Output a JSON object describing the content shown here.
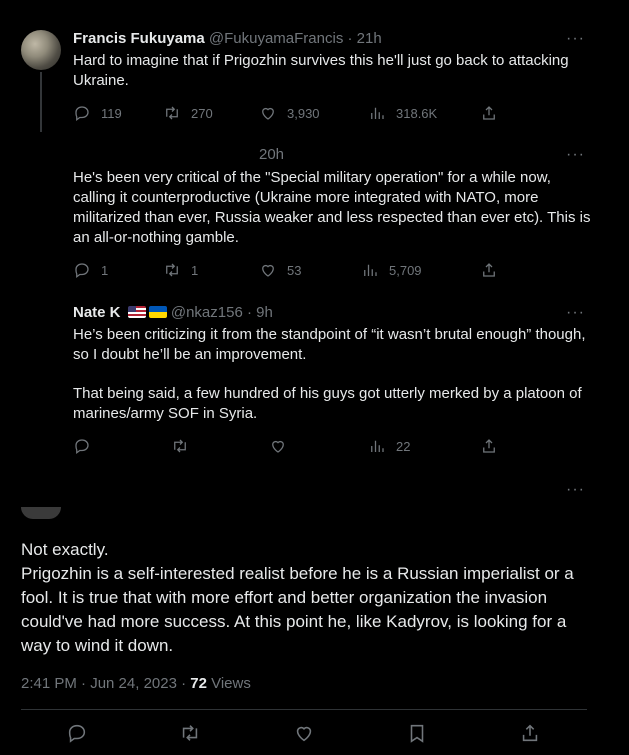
{
  "tweets": [
    {
      "name": "Francis Fukuyama",
      "handle": "@FukuyamaFrancis",
      "time": "· 21h",
      "text": "Hard to imagine that if Prigozhin survives this he'll just go back to attacking Ukraine.",
      "replies": "119",
      "retweets": "270",
      "likes": "3,930",
      "views": "318.6K"
    },
    {
      "name": "",
      "handle": "",
      "time": "20h",
      "text": "He's been very critical of the \"Special military operation\" for a while now, calling it counterproductive (Ukraine more integrated with NATO, more militarized than ever, Russia weaker and less respected than ever etc). This is an all-or-nothing gamble.",
      "replies": "1",
      "retweets": "1",
      "likes": "53",
      "views": "5,709"
    },
    {
      "name": "Nate K",
      "handle": "@nkaz156",
      "time": "· 9h",
      "text_p1": "He’s been criticizing it from the standpoint of “it wasn’t brutal enough” though, so I doubt he’ll be an improvement.",
      "text_p2": "That being said, a few hundred of his guys got utterly merked by a platoon of marines/army SOF in Syria.",
      "replies": "",
      "retweets": "",
      "likes": "",
      "views": "22"
    }
  ],
  "main_tweet": {
    "line1": "Not exactly.",
    "line2": "Prigozhin is a self-interested realist before he is a Russian imperialist or a fool. It is true that with more effort and better organization the invasion could've had more success. At this point he, like Kadyrov, is looking for a way to wind it down.",
    "timestamp": "2:41 PM · Jun 24, 2023 · ",
    "views_count": "72",
    "views_label": " Views"
  },
  "icons": {
    "reply": "reply-icon",
    "retweet": "retweet-icon",
    "like": "like-icon",
    "views": "views-icon",
    "share": "share-icon",
    "bookmark": "bookmark-icon",
    "more": "more-icon"
  },
  "more_label": "···",
  "colors": {
    "background": "#000000",
    "text": "#e7e9ea",
    "muted": "#71767b",
    "divider": "#2f3336"
  }
}
